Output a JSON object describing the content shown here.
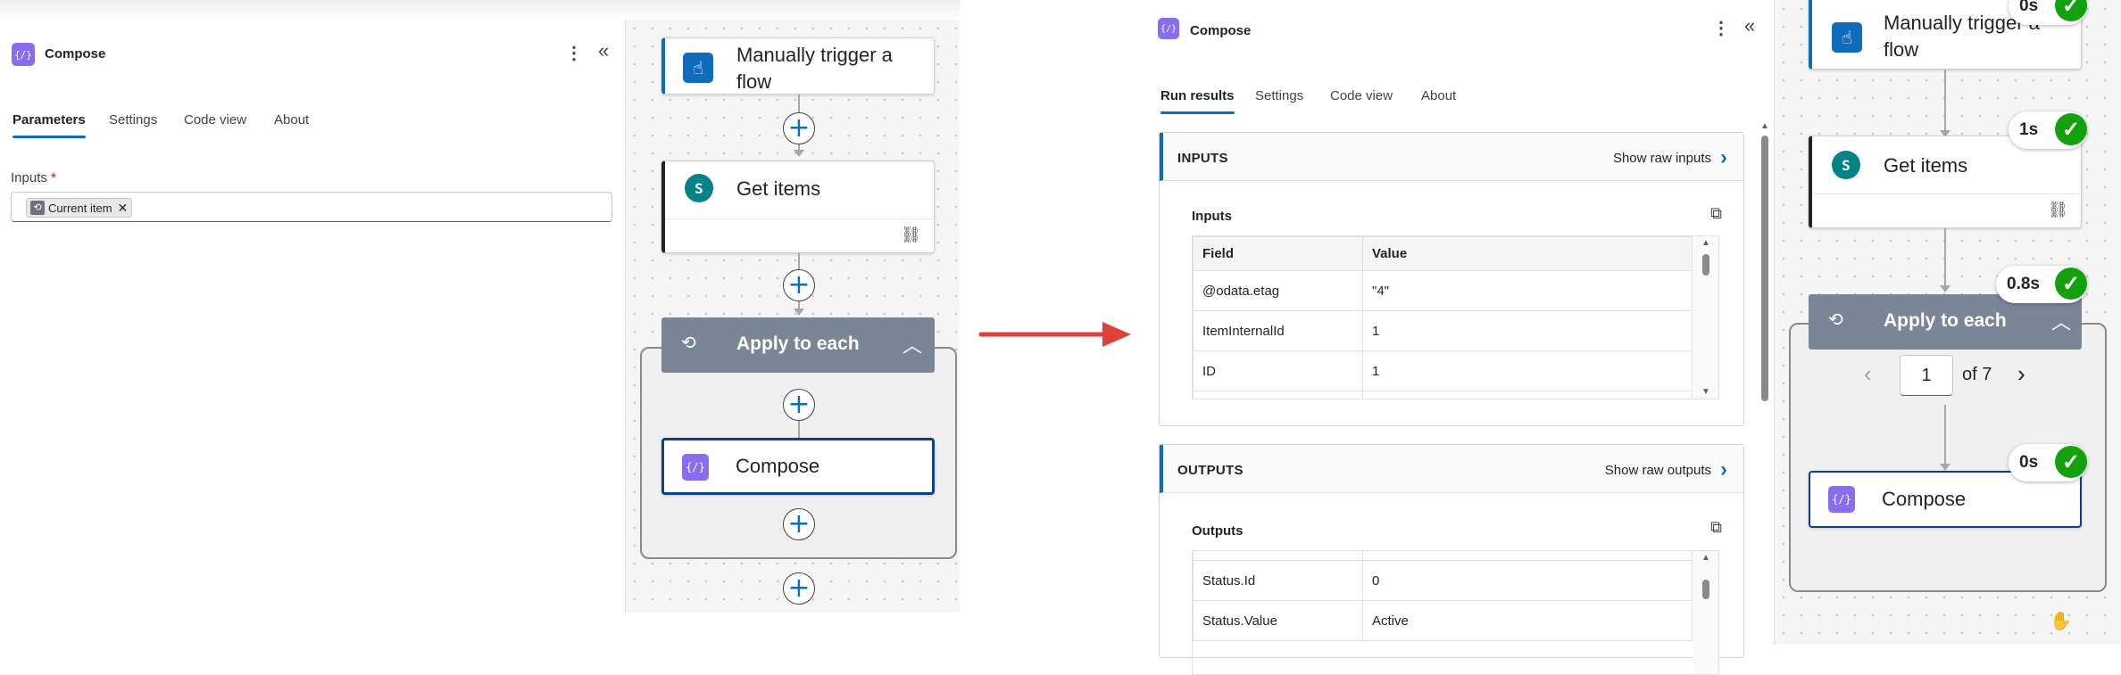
{
  "left_panel": {
    "title": "Compose",
    "icon": "compose-icon",
    "tabs": [
      "Parameters",
      "Settings",
      "Code view",
      "About"
    ],
    "active_tab": "Parameters",
    "inputs_label": "Inputs",
    "required_mark": "*",
    "token_label": "Current item"
  },
  "left_canvas": {
    "trigger_title_line1": "Manually trigger a",
    "trigger_title_line2": "flow",
    "get_items_title": "Get items",
    "apply_title": "Apply to each",
    "compose_title": "Compose",
    "plus_symbol": "+"
  },
  "run_panel": {
    "title": "Compose",
    "tabs": [
      "Run results",
      "Settings",
      "Code view",
      "About"
    ],
    "active_tab": "Run results",
    "inputs_header": "INPUTS",
    "show_raw_inputs": "Show raw inputs",
    "inputs_label": "Inputs",
    "inputs_table": {
      "columns": [
        "Field",
        "Value"
      ],
      "rows": [
        [
          "@odata.etag",
          "\"4\""
        ],
        [
          "ItemInternalId",
          "1"
        ],
        [
          "ID",
          "1"
        ]
      ]
    },
    "outputs_header": "OUTPUTS",
    "show_raw_outputs": "Show raw outputs",
    "outputs_label": "Outputs",
    "outputs_table": {
      "rows": [
        [
          "Status.Id",
          "0"
        ],
        [
          "Status.Value",
          "Active"
        ]
      ]
    }
  },
  "right_canvas": {
    "trigger_title_line1": "Manually trigger a",
    "trigger_title_line2": "flow",
    "trigger_duration": "0s",
    "get_items_title": "Get items",
    "get_items_duration": "1s",
    "apply_title": "Apply to each",
    "apply_duration": "0.8s",
    "page_current": "1",
    "page_of": "of 7",
    "compose_title": "Compose",
    "compose_duration": "0s"
  },
  "colors": {
    "accent": "#0f6cbd",
    "success": "#13a10e",
    "compose_purple": "#8a6cf0",
    "loop_header": "#7a8595",
    "arrow_red": "#e0403a"
  }
}
